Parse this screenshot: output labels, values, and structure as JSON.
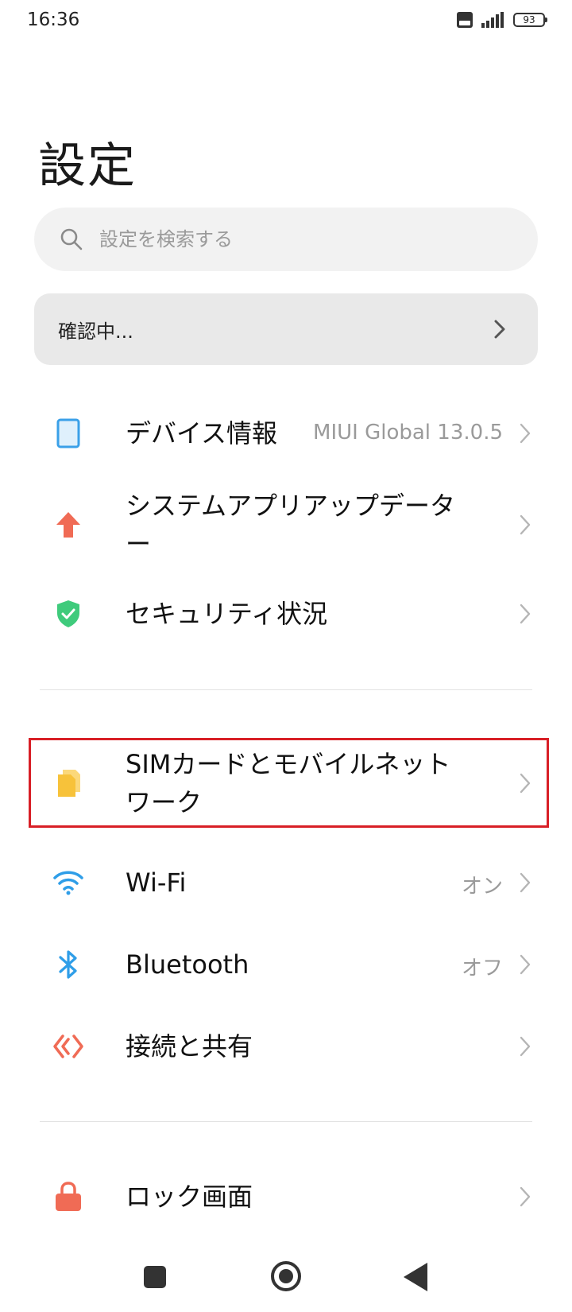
{
  "status_bar": {
    "time": "16:36",
    "battery": "93",
    "icons": [
      "volte-icon",
      "signal-icon",
      "battery-icon"
    ]
  },
  "title": "設定",
  "search": {
    "placeholder": "設定を検索する"
  },
  "checking": {
    "label": "確認中..."
  },
  "items": [
    {
      "label": "デバイス情報",
      "value": "MIUI Global 13.0.5",
      "icon": "device-icon"
    },
    {
      "label": "システムアプリアップデーター",
      "value": "",
      "icon": "update-arrow-icon"
    },
    {
      "label": "セキュリティ状況",
      "value": "",
      "icon": "security-shield-icon"
    },
    {
      "label": "SIMカードとモバイルネットワーク",
      "value": "",
      "icon": "sim-card-icon"
    },
    {
      "label": "Wi-Fi",
      "value": "オン",
      "icon": "wifi-icon"
    },
    {
      "label": "Bluetooth",
      "value": "オフ",
      "icon": "bluetooth-icon"
    },
    {
      "label": "接続と共有",
      "value": "",
      "icon": "connection-share-icon"
    },
    {
      "label": "ロック画面",
      "value": "",
      "icon": "lock-icon"
    }
  ],
  "colors": {
    "device": "#3aa0e8",
    "update": "#f06b55",
    "security": "#3fcb7c",
    "sim": "#f7c23a",
    "wifi": "#2f9ee8",
    "bluetooth": "#2f9ee8",
    "share": "#f06b55",
    "lock": "#f06b55",
    "highlight": "#d81f26"
  }
}
